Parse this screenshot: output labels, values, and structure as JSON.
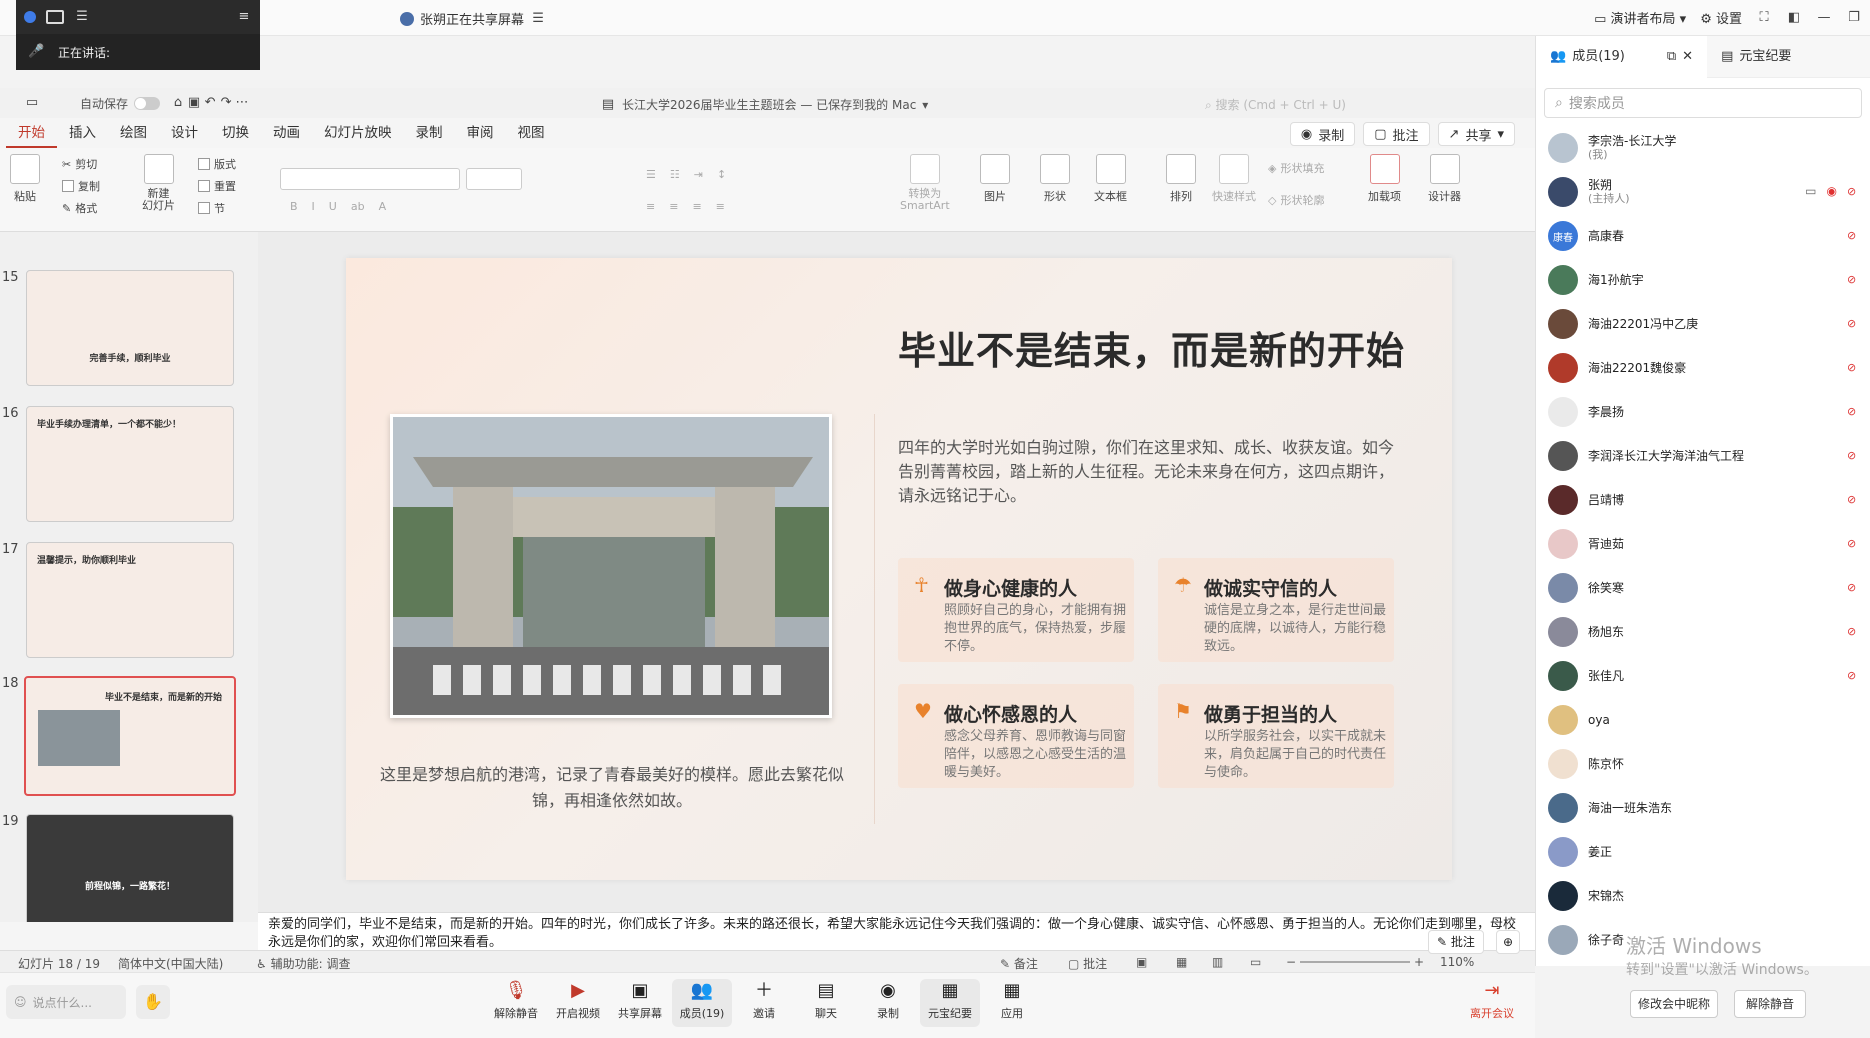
{
  "meeting": {
    "speaking_label": "正在讲话:",
    "share_status": "张朔正在共享屏幕",
    "presenter_layout": "演讲者布局",
    "settings": "设置"
  },
  "ppt": {
    "autosave": "自动保存",
    "doc_title": "长江大学2026届毕业生主题班会 — 已保存到我的 Mac",
    "search_placeholder": "搜索 (Cmd + Ctrl + U)",
    "tabs": [
      "开始",
      "插入",
      "绘图",
      "设计",
      "切换",
      "动画",
      "幻灯片放映",
      "录制",
      "审阅",
      "视图"
    ],
    "right_buttons": {
      "record": "录制",
      "comment": "批注",
      "share": "共享"
    },
    "ribbon": {
      "paste": "粘贴",
      "cut": "剪切",
      "copy": "复制",
      "format": "格式",
      "new_slide": "新建\n幻灯片",
      "layout": "版式",
      "reset": "重置",
      "section": "节",
      "convert_smartart": "转换为\nSmartArt",
      "picture": "图片",
      "shape": "形状",
      "textbox": "文本框",
      "arrange": "排列",
      "quick_styles": "快速样式",
      "shape_fill": "形状填充",
      "shape_outline": "形状轮廓",
      "addins": "加载项",
      "designer": "设计器"
    },
    "thumbs": [
      {
        "num": "15",
        "title": "完善手续，顺利毕业"
      },
      {
        "num": "16",
        "title": "毕业手续办理清单，一个都不能少！"
      },
      {
        "num": "17",
        "title": "温馨提示，助你顺利毕业"
      },
      {
        "num": "18",
        "title": "毕业不是结束，而是新的开始"
      },
      {
        "num": "19",
        "title": "前程似锦，一路繁花！"
      }
    ],
    "slide": {
      "title": "毕业不是结束，而是新的开始",
      "intro": "四年的大学时光如白驹过隙，你们在这里求知、成长、收获友谊。如今告别菁菁校园，踏上新的人生征程。无论未来身在何方，这四点期许，请永远铭记于心。",
      "caption": "这里是梦想启航的港湾，记录了青春最美好的模样。愿此去繁花似锦，再相逢依然如故。",
      "cards": [
        {
          "icon": "person-icon",
          "title": "做身心健康的人",
          "desc": "照顾好自己的身心，才能拥有拥抱世界的底气，保持热爱，步履不停。"
        },
        {
          "icon": "umbrella-icon",
          "title": "做诚实守信的人",
          "desc": "诚信是立身之本，是行走世间最硬的底牌，以诚待人，方能行稳致远。"
        },
        {
          "icon": "heart-icon",
          "title": "做心怀感恩的人",
          "desc": "感念父母养育、恩师教诲与同窗陪伴，以感恩之心感受生活的温暖与美好。"
        },
        {
          "icon": "flag-icon",
          "title": "做勇于担当的人",
          "desc": "以所学服务社会，以实干成就未来，肩负起属于自己的时代责任与使命。"
        }
      ]
    },
    "notes": "亲爱的同学们，毕业不是结束，而是新的开始。四年的时光，你们成长了许多。未来的路还很长，希望大家能永远记住今天我们强调的：做一个身心健康、诚实守信、心怀感恩、勇于担当的人。无论你们走到哪里，母校永远是你们的家，欢迎你们常回来看看。",
    "status": {
      "slide_pos": "幻灯片 18 / 19",
      "language": "简体中文(中国大陆)",
      "accessibility": "辅助功能: 调查",
      "notes_btn": "备注",
      "comments_btn": "批注",
      "zoom": "110%",
      "annotate": "批注"
    }
  },
  "panel": {
    "members_tab": "成员(19)",
    "minutes_tab": "元宝纪要",
    "search_placeholder": "搜索成员",
    "members": [
      {
        "name": "李宗浩-长江大学",
        "sub": "(我)",
        "color": "#b8c4d0",
        "muted": false
      },
      {
        "name": "张朔",
        "sub": "(主持人)",
        "color": "#3a4a6a",
        "muted": true,
        "recording": true
      },
      {
        "name": "高康春",
        "sub": "",
        "color": "#3a78d8",
        "muted": true,
        "initials": "康春"
      },
      {
        "name": "海1孙航宇",
        "sub": "",
        "color": "#4a7a5a",
        "muted": true
      },
      {
        "name": "海油22201冯中乙庚",
        "sub": "",
        "color": "#6a4a3a",
        "muted": true
      },
      {
        "name": "海油22201魏俊豪",
        "sub": "",
        "color": "#b03a2a",
        "muted": true
      },
      {
        "name": "李晨扬",
        "sub": "",
        "color": "#eaeaea",
        "muted": true
      },
      {
        "name": "李润泽长江大学海洋油气工程",
        "sub": "",
        "color": "#555",
        "muted": true
      },
      {
        "name": "吕靖博",
        "sub": "",
        "color": "#5a2a2a",
        "muted": true
      },
      {
        "name": "胥迪茹",
        "sub": "",
        "color": "#e8c8c8",
        "muted": true
      },
      {
        "name": "徐笑寒",
        "sub": "",
        "color": "#7a8aa8",
        "muted": true
      },
      {
        "name": "杨旭东",
        "sub": "",
        "color": "#8a8a9a",
        "muted": true
      },
      {
        "name": "张佳凡",
        "sub": "",
        "color": "#3a5a4a",
        "muted": true
      },
      {
        "name": "oya",
        "sub": "",
        "color": "#e0c080",
        "muted": false
      },
      {
        "name": "陈京怀",
        "sub": "",
        "color": "#f0e0d0",
        "muted": false
      },
      {
        "name": "海油一班朱浩东",
        "sub": "",
        "color": "#4a6a8a",
        "muted": false
      },
      {
        "name": "姜正",
        "sub": "",
        "color": "#8a9ac8",
        "muted": false
      },
      {
        "name": "宋锦杰",
        "sub": "",
        "color": "#1a2a3a",
        "muted": false
      },
      {
        "name": "徐子奇",
        "sub": "",
        "color": "#9aa8b8",
        "muted": false
      }
    ],
    "rename_button": "修改会中昵称",
    "unmute_button": "解除静音",
    "watermark_title": "激活 Windows",
    "watermark_sub": "转到\"设置\"以激活 Windows。"
  },
  "toolbar": {
    "say_placeholder": "说点什么...",
    "buttons": [
      {
        "label": "解除静音",
        "icon": "mic-muted-icon"
      },
      {
        "label": "开启视频",
        "icon": "camera-off-icon"
      },
      {
        "label": "共享屏幕",
        "icon": "screen-share-icon"
      },
      {
        "label": "成员(19)",
        "icon": "members-icon"
      },
      {
        "label": "邀请",
        "icon": "invite-icon"
      },
      {
        "label": "聊天",
        "icon": "chat-icon"
      },
      {
        "label": "录制",
        "icon": "record-icon"
      },
      {
        "label": "元宝纪要",
        "icon": "minutes-icon"
      },
      {
        "label": "应用",
        "icon": "apps-icon"
      }
    ],
    "leave": "离开会议"
  }
}
